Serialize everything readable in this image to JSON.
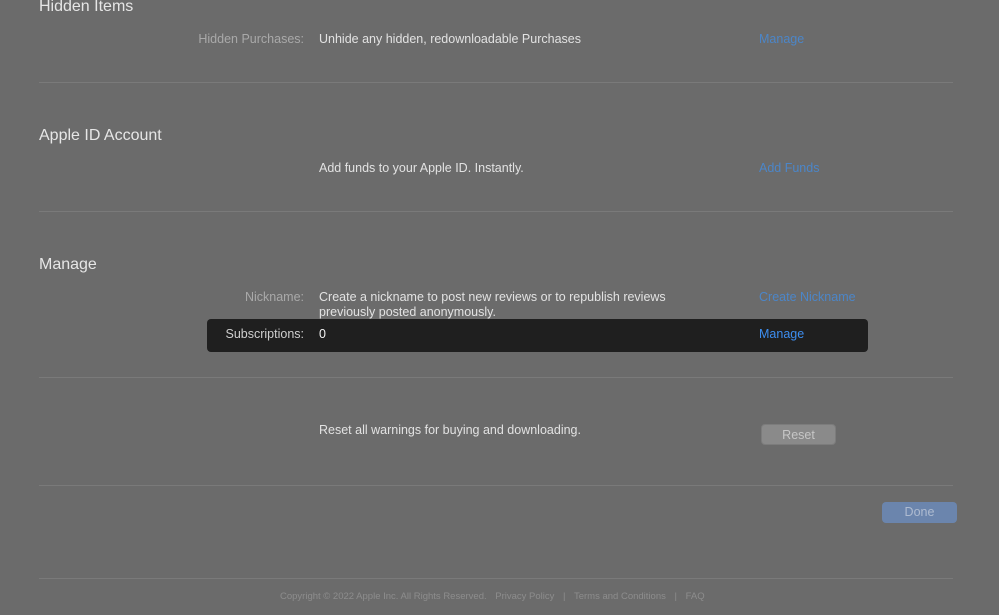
{
  "hidden_items": {
    "title": "Hidden Items",
    "purchases_label": "Hidden Purchases:",
    "purchases_text": "Unhide any hidden, redownloadable Purchases",
    "purchases_link": "Manage"
  },
  "apple_id_account": {
    "title": "Apple ID Account",
    "funds_text": "Add funds to your Apple ID. Instantly.",
    "funds_link": "Add Funds"
  },
  "manage": {
    "title": "Manage",
    "nickname_label": "Nickname:",
    "nickname_text": "Create a nickname to post new reviews or to republish reviews previously posted anonymously.",
    "nickname_link": "Create Nickname",
    "subscriptions_label": "Subscriptions:",
    "subscriptions_value": "0",
    "subscriptions_link": "Manage"
  },
  "reset": {
    "text": "Reset all warnings for buying and downloading.",
    "button_label": "Reset"
  },
  "done_label": "Done",
  "footer": {
    "copyright": "Copyright © 2022 Apple Inc. All Rights Reserved.",
    "privacy": "Privacy Policy",
    "terms": "Terms and Conditions",
    "faq": "FAQ",
    "separator": "|"
  },
  "colors": {
    "background": "#6b6b6b",
    "link": "#4c86c8",
    "highlight_bg": "#1f1f1f",
    "done_button": "#6b85ad"
  }
}
